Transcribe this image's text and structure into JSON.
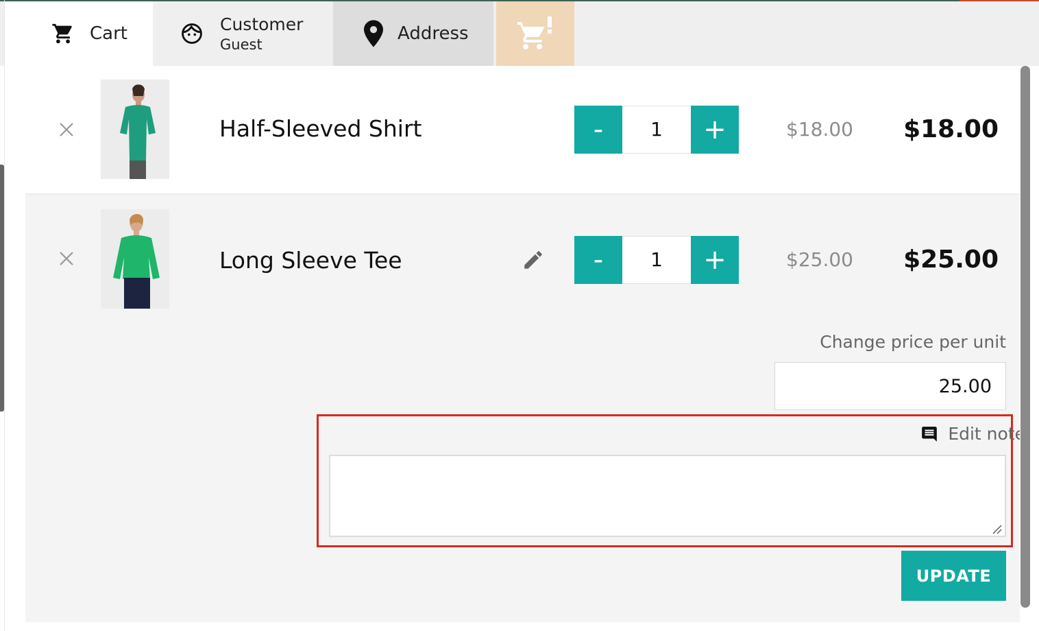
{
  "tabs": {
    "cart_label": "Cart",
    "customer_label": "Customer",
    "customer_sub": "Guest",
    "address_label": "Address",
    "warning_icon": "cart-warning-icon"
  },
  "items": [
    {
      "name": "Half-Sleeved Shirt",
      "quantity": "1",
      "unit_price": "$18.00",
      "total_price": "$18.00",
      "image_color": "#1e9e7e"
    },
    {
      "name": "Long Sleeve Tee",
      "quantity": "1",
      "unit_price": "$25.00",
      "total_price": "$25.00",
      "image_color": "#1fb56a"
    }
  ],
  "qty_controls": {
    "minus_label": "-",
    "plus_label": "+"
  },
  "edit_panel": {
    "change_price_label": "Change price per unit",
    "price_value": "25.00",
    "note_label": "Edit note",
    "note_value": "",
    "update_label": "UPDATE"
  },
  "colors": {
    "accent": "#13aaa3",
    "highlight": "#d52b1e",
    "warning_tab": "#efd7b7"
  }
}
